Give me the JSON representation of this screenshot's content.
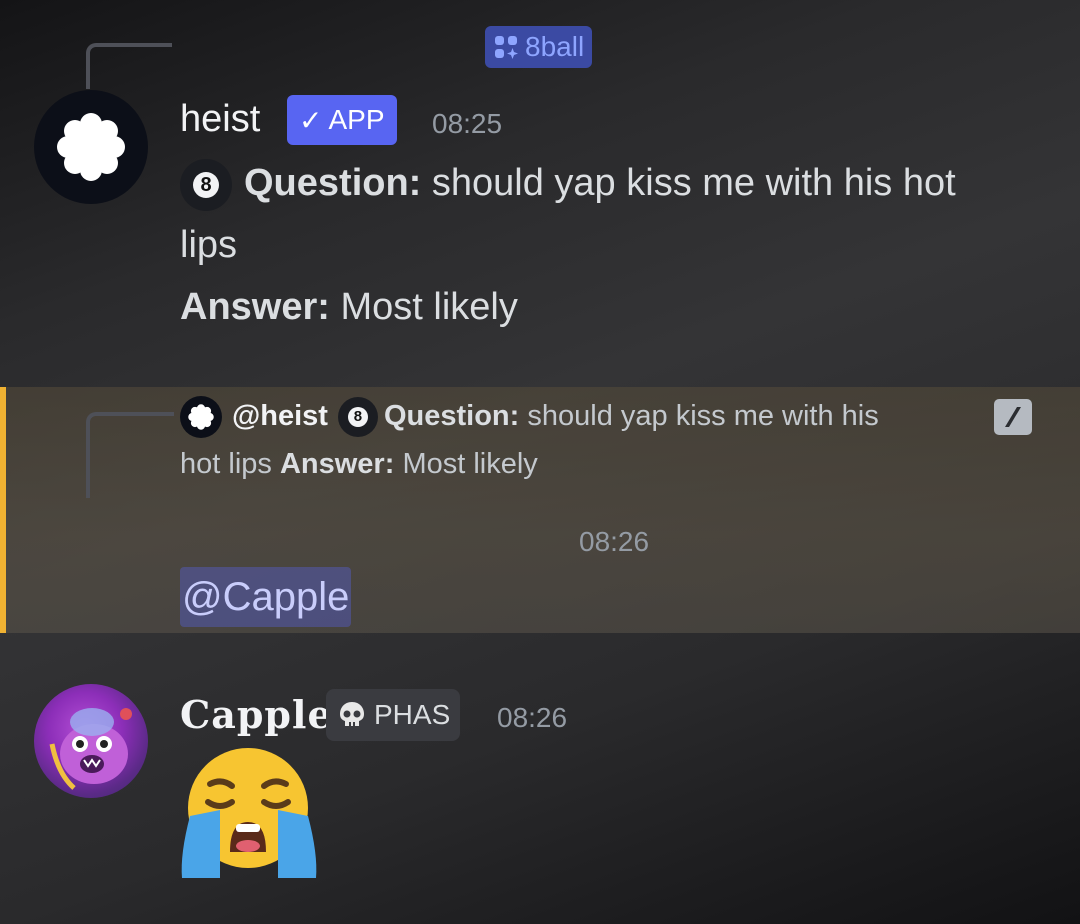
{
  "command": {
    "icon": "app-command-icon",
    "label": "8ball"
  },
  "message1": {
    "username": "heist",
    "badge": "APP",
    "badge_check": "✓",
    "time": "08:25",
    "ball_number": "8",
    "question_label": "Question:",
    "question_text": "should yap kiss me with his hot",
    "question_text_cont": "lips",
    "answer_label": "Answer:",
    "answer_text": "Most likely"
  },
  "reply": {
    "mention_name": "@heist",
    "ball_number": "8",
    "question_label": "Question:",
    "question_text": "should yap kiss me with his",
    "question_text_cont": "hot lips",
    "answer_label": "Answer:",
    "answer_text": "Most likely",
    "icon": "slash-command-icon"
  },
  "message2": {
    "time": "08:26",
    "mention": "@Capple"
  },
  "message3": {
    "username": "Capple",
    "tag_icon": "skull-icon",
    "tag": "PHAS",
    "time": "08:26",
    "emoji": "loudly-crying-face-icon"
  },
  "colors": {
    "accent": "#5865f2",
    "mention_bar": "#f0b232",
    "command_pill": "#3b4aa3",
    "command_text": "#8ea5ff"
  }
}
